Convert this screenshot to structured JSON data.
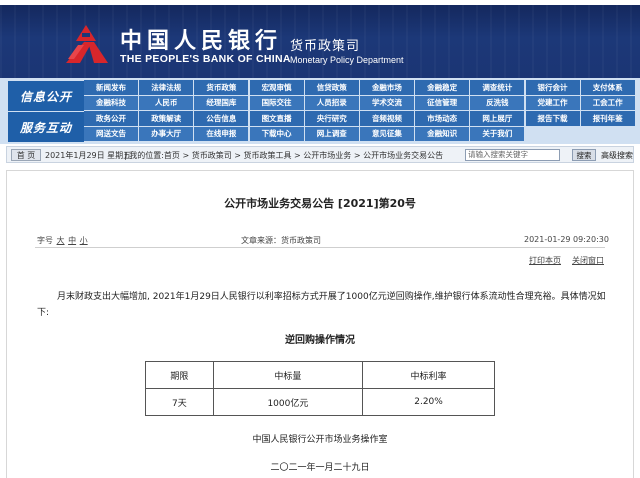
{
  "header": {
    "bank_name_cn": "中国人民银行",
    "bank_name_en": "THE PEOPLE'S BANK OF CHINA",
    "department_cn": "货币政策司",
    "department_en": "Monetary Policy Department"
  },
  "nav": {
    "section1": "信息公开",
    "section2": "服务互动",
    "rows": [
      [
        "新闻发布",
        "法律法规",
        "货币政策",
        "宏观审慎",
        "信贷政策",
        "金融市场",
        "金融稳定",
        "调查统计",
        "银行会计",
        "支付体系"
      ],
      [
        "金融科技",
        "人民币",
        "经理国库",
        "国际交往",
        "人员招录",
        "学术交流",
        "征信管理",
        "反洗钱",
        "党建工作",
        "工会工作"
      ],
      [
        "政务公开",
        "政策解读",
        "公告信息",
        "图文直播",
        "央行研究",
        "音频视频",
        "市场动态",
        "网上展厅",
        "报告下载",
        "报刊年鉴"
      ],
      [
        "网送文告",
        "办事大厅",
        "在线申报",
        "下载中心",
        "网上调查",
        "意见征集",
        "金融知识",
        "关于我们"
      ]
    ]
  },
  "breadcrumb": {
    "home_label": "首 页",
    "date": "2021年1月29日 星期五",
    "path": "| 我的位置:首页 > 货币政策司 > 货币政策工具 > 公开市场业务 > 公开市场业务交易公告",
    "search_placeholder": "请输入搜索关键字",
    "search_button": "搜索",
    "advanced_search": "高级搜索"
  },
  "article": {
    "title": "公开市场业务交易公告 [2021]第20号",
    "font_size_label": "字号",
    "font_sizes": [
      "大",
      "中",
      "小"
    ],
    "source": "文章来源：货币政策司",
    "datetime": "2021-01-29 09:20:30",
    "print_link": "打印本页",
    "close_link": "关闭窗口",
    "body": "月末财政支出大幅增加, 2021年1月29日人民银行以利率招标方式开展了1000亿元逆回购操作,维护银行体系流动性合理充裕。具体情况如下:",
    "table_title": "逆回购操作情况",
    "table": {
      "headers": [
        "期限",
        "中标量",
        "中标利率"
      ],
      "rows": [
        [
          "7天",
          "1000亿元",
          "2.20%"
        ]
      ]
    },
    "signature": "中国人民银行公开市场业务操作室",
    "sign_date": "二〇二一年一月二十九日"
  }
}
